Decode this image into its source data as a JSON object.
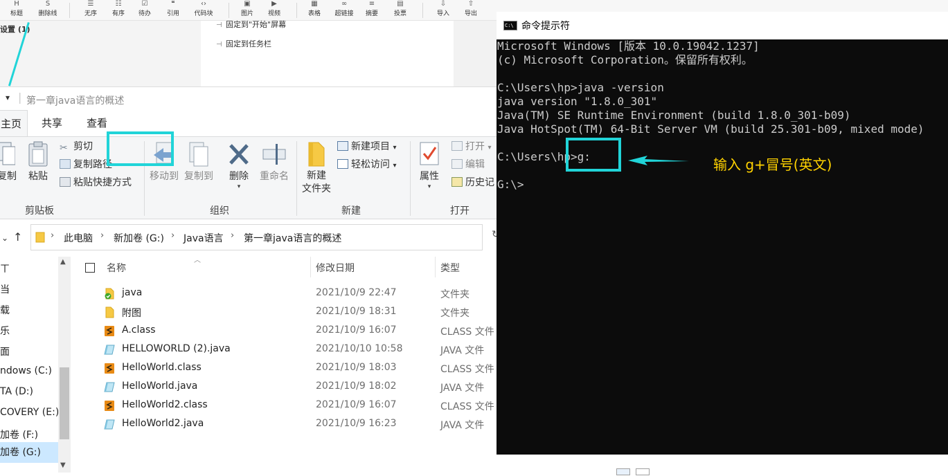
{
  "editor": {
    "toolbar": [
      {
        "icon": "H",
        "label": "标题",
        "icon_name": "heading-icon"
      },
      {
        "icon": "S",
        "label": "删除线",
        "icon_name": "strikethrough-icon"
      },
      {
        "icon": "☰",
        "label": "无序",
        "icon_name": "unordered-list-icon"
      },
      {
        "icon": "☷",
        "label": "有序",
        "icon_name": "ordered-list-icon"
      },
      {
        "icon": "☑",
        "label": "待办",
        "icon_name": "todo-icon"
      },
      {
        "icon": "❝",
        "label": "引用",
        "icon_name": "quote-icon"
      },
      {
        "icon": "‹›",
        "label": "代码块",
        "icon_name": "code-block-icon"
      },
      {
        "icon": "▣",
        "label": "图片",
        "icon_name": "image-icon"
      },
      {
        "icon": "▶",
        "label": "视频",
        "icon_name": "video-icon"
      },
      {
        "icon": "▦",
        "label": "表格",
        "icon_name": "table-icon"
      },
      {
        "icon": "∞",
        "label": "超链接",
        "icon_name": "link-icon"
      },
      {
        "icon": "≡",
        "label": "摘要",
        "icon_name": "summary-icon"
      },
      {
        "icon": "▤",
        "label": "投票",
        "icon_name": "vote-icon"
      },
      {
        "icon": "⇩",
        "label": "导入",
        "icon_name": "import-icon"
      },
      {
        "icon": "⇧",
        "label": "导出",
        "icon_name": "export-icon"
      }
    ],
    "settings_label": "设置 (1)",
    "menu_items": [
      "固定到\"开始\"屏幕",
      "固定到任务栏"
    ]
  },
  "explorer": {
    "title": "第一章java语言的概述",
    "tabs": [
      "主页",
      "共享",
      "查看"
    ],
    "ribbon": {
      "clipboard": {
        "copy_label": "复制",
        "paste_label": "粘贴",
        "cut": "剪切",
        "copy_path": "复制路径",
        "paste_shortcut": "粘贴快捷方式",
        "group_label": "剪贴板"
      },
      "organize": {
        "move_to": "移动到",
        "copy_to": "复制到",
        "delete": "删除",
        "rename": "重命名",
        "group_label": "组织"
      },
      "new": {
        "new_folder": "新建\n文件夹",
        "new_folder_line1": "新建",
        "new_folder_line2": "文件夹",
        "new_item": "新建项目",
        "easy_access": "轻松访问",
        "group_label": "新建"
      },
      "open": {
        "properties": "属性",
        "open": "打开",
        "edit": "编辑",
        "history": "历史记",
        "group_label": "打开"
      }
    },
    "address": {
      "crumbs": [
        "此电脑",
        "新加卷 (G:)",
        "Java语言",
        "第一章java语言的概述"
      ]
    },
    "nav_items": [
      "ㄒ",
      "当",
      "载",
      "乐",
      "面",
      "ndows (C:)",
      "TA (D:)",
      "COVERY (E:)",
      "加卷 (F:)",
      "加卷 (G:)"
    ],
    "columns": {
      "name": "名称",
      "date": "修改日期",
      "type": "类型"
    },
    "files": [
      {
        "name": "java",
        "date": "2021/10/9 22:47",
        "type": "文件夹",
        "kind": "folder-sync"
      },
      {
        "name": "附图",
        "date": "2021/10/9 18:31",
        "type": "文件夹",
        "kind": "folder"
      },
      {
        "name": "A.class",
        "date": "2021/10/9 16:07",
        "type": "CLASS 文件",
        "kind": "class"
      },
      {
        "name": "HELLOWORLD (2).java",
        "date": "2021/10/10 10:58",
        "type": "JAVA 文件",
        "kind": "java"
      },
      {
        "name": "HelloWorld.class",
        "date": "2021/10/9 18:03",
        "type": "CLASS 文件",
        "kind": "class"
      },
      {
        "name": "HelloWorld.java",
        "date": "2021/10/9 18:02",
        "type": "JAVA 文件",
        "kind": "java"
      },
      {
        "name": "HelloWorld2.class",
        "date": "2021/10/9 16:07",
        "type": "CLASS 文件",
        "kind": "class"
      },
      {
        "name": "HelloWorld2.java",
        "date": "2021/10/9 16:23",
        "type": "JAVA 文件",
        "kind": "java"
      }
    ]
  },
  "cmd": {
    "icon_text": "C:\\",
    "title": "命令提示符",
    "lines": [
      "Microsoft Windows [版本 10.0.19042.1237]",
      "(c) Microsoft Corporation。保留所有权利。",
      "",
      "C:\\Users\\hp>java -version",
      "java version \"1.8.0_301\"",
      "Java(TM) SE Runtime Environment (build 1.8.0_301-b09)",
      "Java HotSpot(TM) 64-Bit Server VM (build 25.301-b09, mixed mode)",
      "",
      "C:\\Users\\hp>g:",
      "",
      "G:\\>"
    ],
    "annotation": "输入 g+冒号(英文)"
  },
  "colors": {
    "highlight": "#21d4d8",
    "annotation": "#ffd200",
    "cmd_bg": "#0c0c0c",
    "cmd_text": "#cccccc",
    "selection": "#cce8ff"
  }
}
